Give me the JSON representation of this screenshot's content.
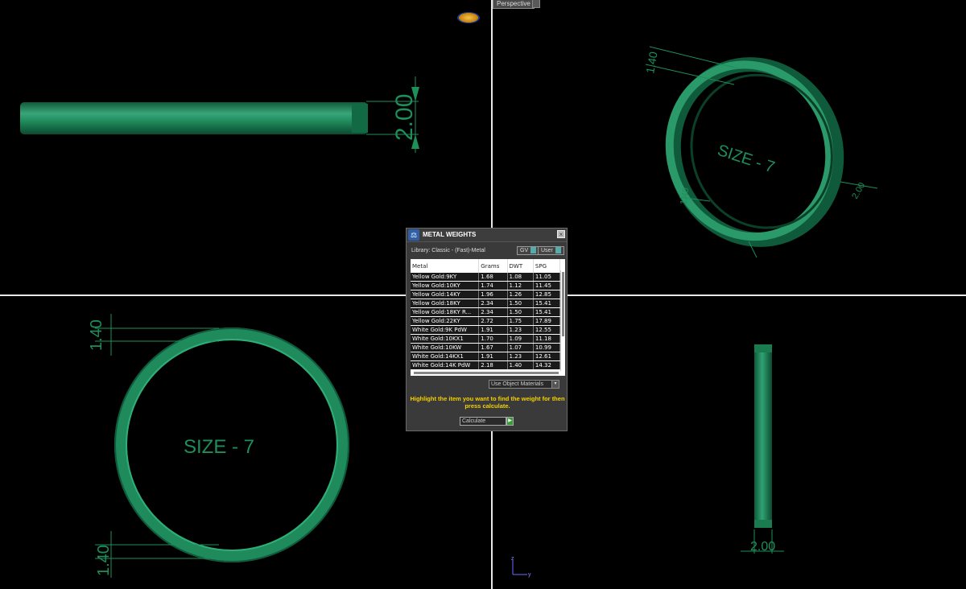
{
  "viewport": {
    "label": "Perspective",
    "top_dimension": "2.00",
    "right_top_dimension": "1.40",
    "right_side_dimension_a": "1.40",
    "right_side_dimension_b": "2.00",
    "right_engraving": "SIZE - 7",
    "bottom_left_top_dimension": "1.40",
    "bottom_left_bottom_dimension": "1.40",
    "bottom_left_engraving": "SIZE - 7",
    "bottom_right_dimension": "2.00",
    "axis_z": "z",
    "axis_y": "y"
  },
  "dialog": {
    "title": "METAL WEIGHTS",
    "close": "×",
    "library_label": "Library: Classic - (Fast)-Metal",
    "unit_gv": "GV",
    "unit_user": "User",
    "columns": [
      "Metal",
      "Grams",
      "DWT",
      "SPG"
    ],
    "rows": [
      {
        "metal": "Yellow Gold:9KY",
        "grams": "1.68",
        "dwt": "1.08",
        "spg": "11.05"
      },
      {
        "metal": "Yellow Gold:10KY",
        "grams": "1.74",
        "dwt": "1.12",
        "spg": "11.45"
      },
      {
        "metal": "Yellow Gold:14KY",
        "grams": "1.96",
        "dwt": "1.26",
        "spg": "12.85"
      },
      {
        "metal": "Yellow Gold:18KY",
        "grams": "2.34",
        "dwt": "1.50",
        "spg": "15.41"
      },
      {
        "metal": "Yellow Gold:18KY R...",
        "grams": "2.34",
        "dwt": "1.50",
        "spg": "15.41"
      },
      {
        "metal": "Yellow Gold:22KY",
        "grams": "2.72",
        "dwt": "1.75",
        "spg": "17.89"
      },
      {
        "metal": "White Gold:9K PdW",
        "grams": "1.91",
        "dwt": "1.23",
        "spg": "12.55"
      },
      {
        "metal": "White Gold:10KX1",
        "grams": "1.70",
        "dwt": "1.09",
        "spg": "11.18"
      },
      {
        "metal": "White Gold:10KW",
        "grams": "1.67",
        "dwt": "1.07",
        "spg": "10.99"
      },
      {
        "metal": "White Gold:14KX1",
        "grams": "1.91",
        "dwt": "1.23",
        "spg": "12.61"
      },
      {
        "metal": "White Gold:14K PdW",
        "grams": "2.18",
        "dwt": "1.40",
        "spg": "14.32"
      }
    ],
    "materials_option": "Use Object Materials",
    "hint": "Highlight the item you want to find the weight for then press calculate.",
    "calculate_label": "Calculate"
  },
  "colors": {
    "ring": "#1f8a5c",
    "dimension": "#1f8f5a",
    "hint": "#f5d000"
  }
}
